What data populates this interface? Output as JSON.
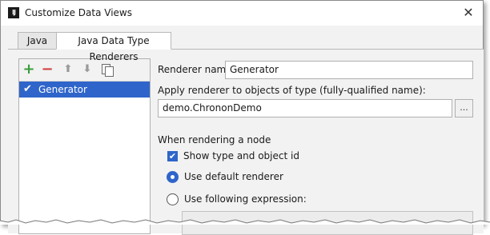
{
  "window": {
    "title": "Customize Data Views",
    "app_icon_text": "IJ"
  },
  "tabs": [
    {
      "label": "Java",
      "active": false
    },
    {
      "label": "Java Data Type Renderers",
      "active": true
    }
  ],
  "toolbar": {
    "add_symbol": "+",
    "remove_symbol": "−",
    "up_symbol": "⬆",
    "down_symbol": "⬇"
  },
  "renderers_list": [
    {
      "label": "Generator",
      "checked": true,
      "selected": true
    }
  ],
  "form": {
    "renderer_name_label": "Renderer name:",
    "renderer_name_value": "Generator",
    "apply_label": "Apply renderer to objects of type (fully-qualified name):",
    "type_value": "demo.ChrononDemo",
    "browse_label": "...",
    "rendering_node_label": "When rendering a node",
    "show_type_label": "Show type and object id",
    "show_type_checked": true,
    "default_renderer_label": "Use default renderer",
    "default_renderer_selected": true,
    "expression_label": "Use following expression:",
    "expression_selected": false
  },
  "colors": {
    "accent": "#2f65ca",
    "add": "#3a9c3a",
    "remove": "#d04040"
  }
}
